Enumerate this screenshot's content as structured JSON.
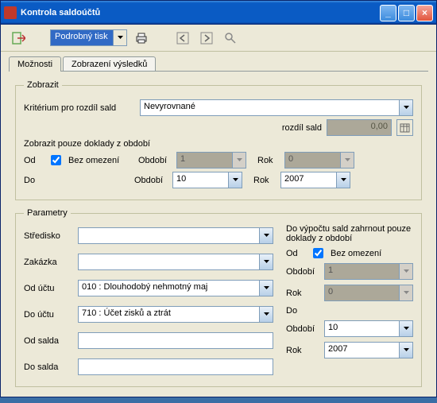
{
  "window_title": "Kontrola saldoúčtů",
  "toolbar": {
    "mode": "Podrobný tisk"
  },
  "tabs": {
    "t1": "Možnosti",
    "t2": "Zobrazení výsledků"
  },
  "zobrazit": {
    "legend": "Zobrazit",
    "criterion_label": "Kritérium pro rozdíl sald",
    "criterion_value": "Nevyrovnané",
    "diff_label": "rozdíl sald",
    "diff_value": "0,00",
    "show_only_label": "Zobrazit pouze doklady z období",
    "od": "Od",
    "do": "Do",
    "no_limit": "Bez omezení",
    "period_label": "Období",
    "year_label": "Rok",
    "od_period": "1",
    "od_year": "0",
    "do_period": "10",
    "do_year": "2007"
  },
  "params": {
    "legend": "Parametry",
    "stredisko": "Středisko",
    "zakazka": "Zakázka",
    "od_uctu": "Od účtu",
    "do_uctu": "Do účtu",
    "od_salda": "Od salda",
    "do_salda": "Do salda",
    "od_uctu_val": "010   : Dlouhodobý nehmotný maj",
    "do_uctu_val": "710   : Účet zisků a ztrát",
    "right_header": "Do výpočtu sald zahrnout pouze doklady z období",
    "od": "Od",
    "do": "Do",
    "no_limit": "Bez omezení",
    "period_label": "Období",
    "year_label": "Rok",
    "od_period": "1",
    "od_year": "0",
    "do_period": "10",
    "do_year": "2007"
  }
}
